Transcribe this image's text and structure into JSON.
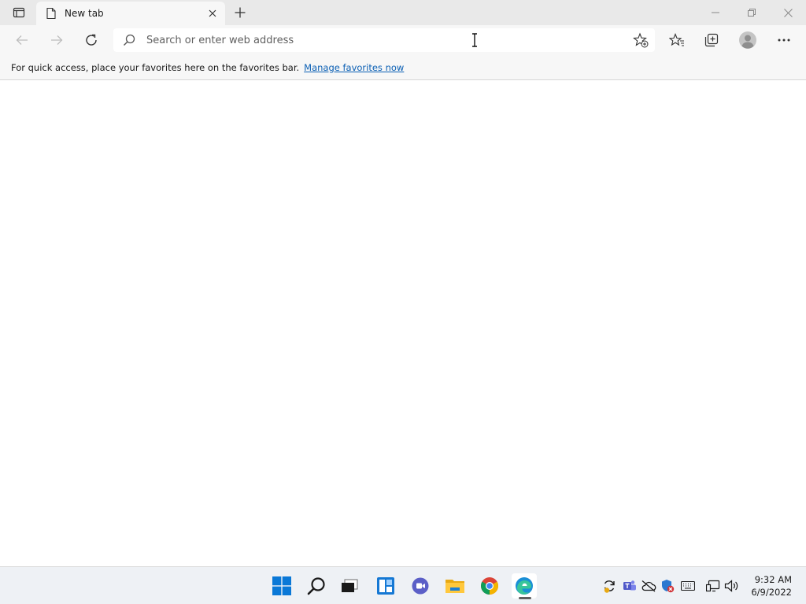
{
  "browser": {
    "tab": {
      "title": "New tab"
    },
    "toolbar": {
      "address_placeholder": "Search or enter web address"
    },
    "favorites_bar": {
      "message": "For quick access, place your favorites here on the favorites bar.",
      "link_label": "Manage favorites now"
    }
  },
  "taskbar": {
    "clock": {
      "time": "9:32 AM",
      "date": "6/9/2022"
    }
  },
  "colors": {
    "accent": "#0a5fb4",
    "titlebar": "#e9e9e9",
    "toolbar": "#f7f7f7",
    "taskbar": "#eef1f5"
  }
}
